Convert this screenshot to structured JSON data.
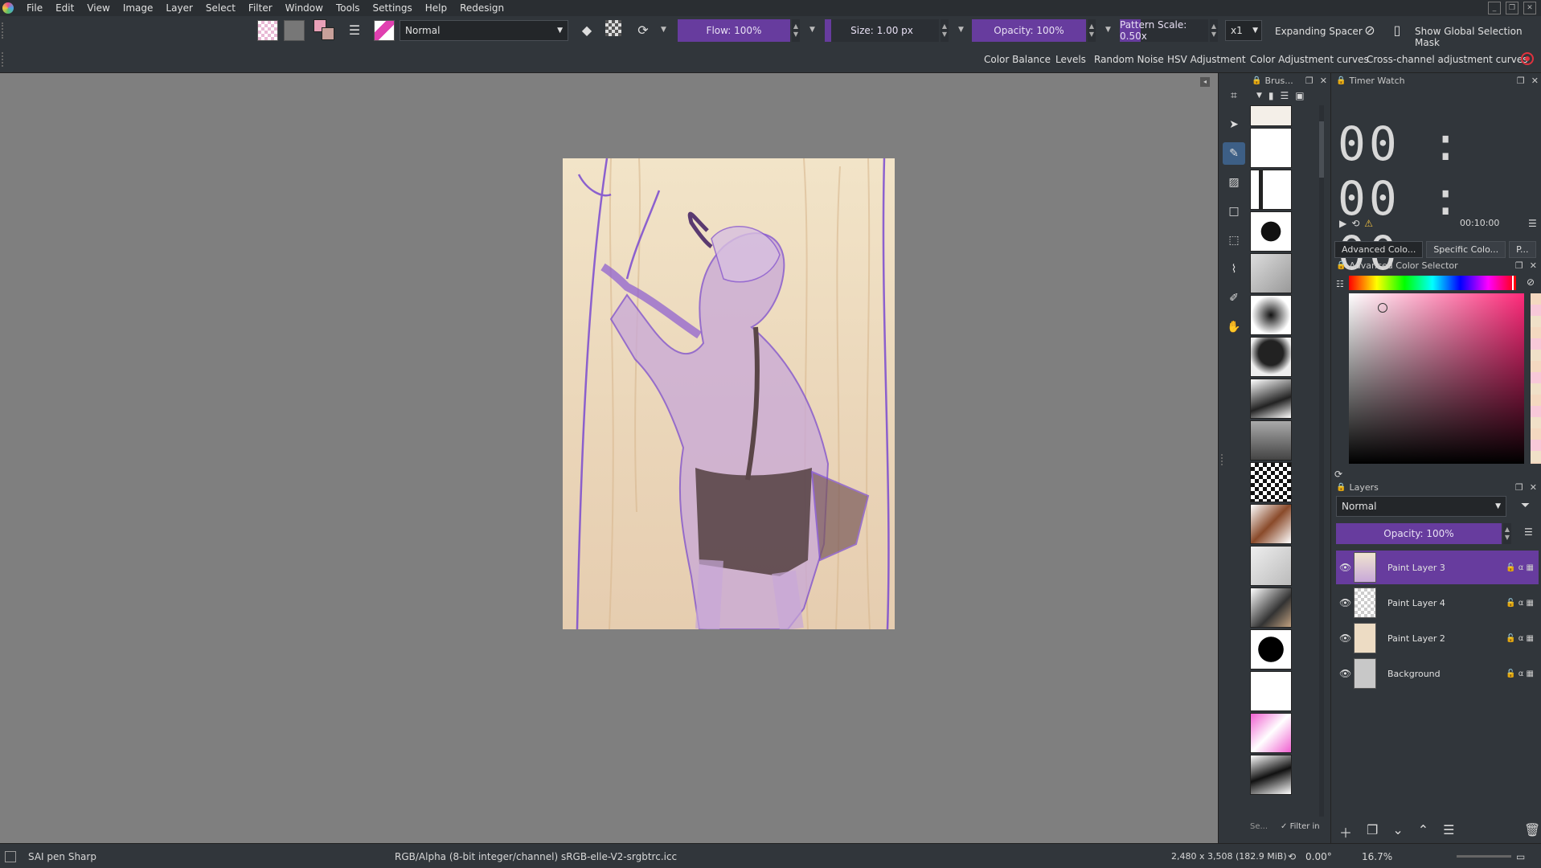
{
  "menu": [
    "File",
    "Edit",
    "View",
    "Image",
    "Layer",
    "Select",
    "Filter",
    "Window",
    "Tools",
    "Settings",
    "Help",
    "Redesign"
  ],
  "toolbar": {
    "blend_mode": "Normal",
    "flow": "Flow: 100%",
    "size": "Size: 1.00 px",
    "opacity": "Opacity: 100%",
    "pattern_scale": "Pattern Scale: 0.50x",
    "multiplier": "x1",
    "expanding_spacer": "Expanding Spacer",
    "show_global_selection_mask": "Show Global Selection Mask"
  },
  "filters": [
    "Color Balance",
    "Levels",
    "Random Noise",
    "HSV Adjustment",
    "Color Adjustment curves",
    "Cross-channel adjustment curves"
  ],
  "brush_docker": {
    "title": "Brus...",
    "search": "Se...",
    "filter": "Filter in"
  },
  "timer": {
    "title": "Timer Watch",
    "display": "00 : 00 : 00",
    "alarm": "00:10:00"
  },
  "color": {
    "tabs": [
      "Advanced Colo...",
      "Specific Colo...",
      "P..."
    ],
    "title": "Advanced Color Selector"
  },
  "layers": {
    "title": "Layers",
    "blend": "Normal",
    "opacity": "Opacity:  100%",
    "items": [
      {
        "name": "Paint Layer 3",
        "selected": true
      },
      {
        "name": "Paint Layer 4",
        "selected": false
      },
      {
        "name": "Paint Layer 2",
        "selected": false
      },
      {
        "name": "Background",
        "selected": false
      }
    ]
  },
  "status": {
    "brush": "SAI pen Sharp",
    "color_space": "RGB/Alpha (8-bit integer/channel)  sRGB-elle-V2-srgbtrc.icc",
    "dimensions": "2,480 x 3,508 (182.9 MiB)",
    "rotation": "0.00°",
    "zoom": "16.7%"
  },
  "colors": {
    "accent": "#673c9e",
    "canvas_bg": "#7f7f7f",
    "panel_bg": "#31363b"
  }
}
